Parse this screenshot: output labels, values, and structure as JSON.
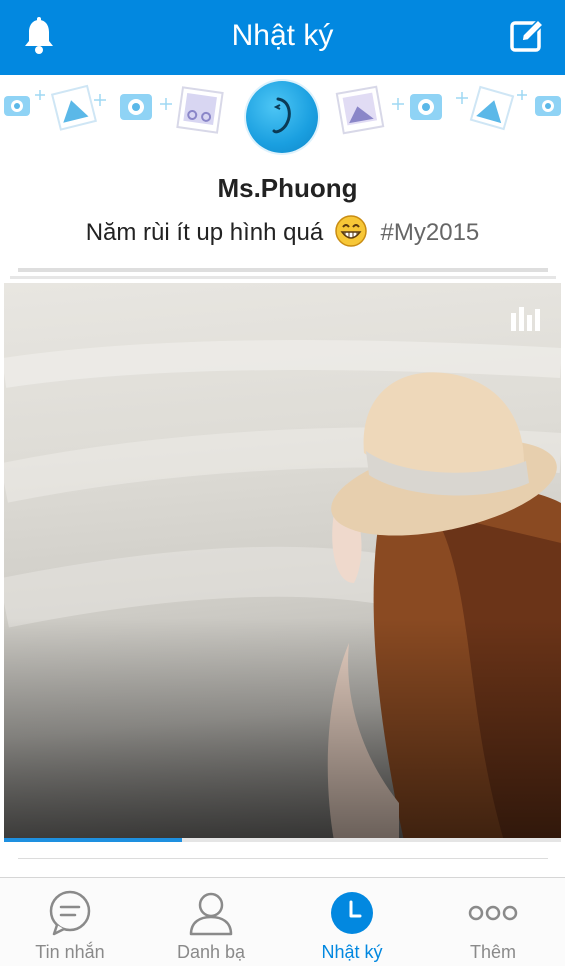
{
  "header": {
    "title": "Nhật ký"
  },
  "post": {
    "author": "Ms.Phuong",
    "status_text": "Năm rùi ít up hình quá",
    "hashtag": "#My2015",
    "progress": 0.32
  },
  "tabs": [
    {
      "label": "Tin nhắn",
      "icon": "chat-icon",
      "active": false
    },
    {
      "label": "Danh bạ",
      "icon": "contacts-icon",
      "active": false
    },
    {
      "label": "Nhật ký",
      "icon": "clock-icon",
      "active": true
    },
    {
      "label": "Thêm",
      "icon": "more-icon",
      "active": false
    }
  ],
  "colors": {
    "brand": "#0288e0",
    "progress": "#1e90e0",
    "inactive": "#8a8a8a"
  }
}
